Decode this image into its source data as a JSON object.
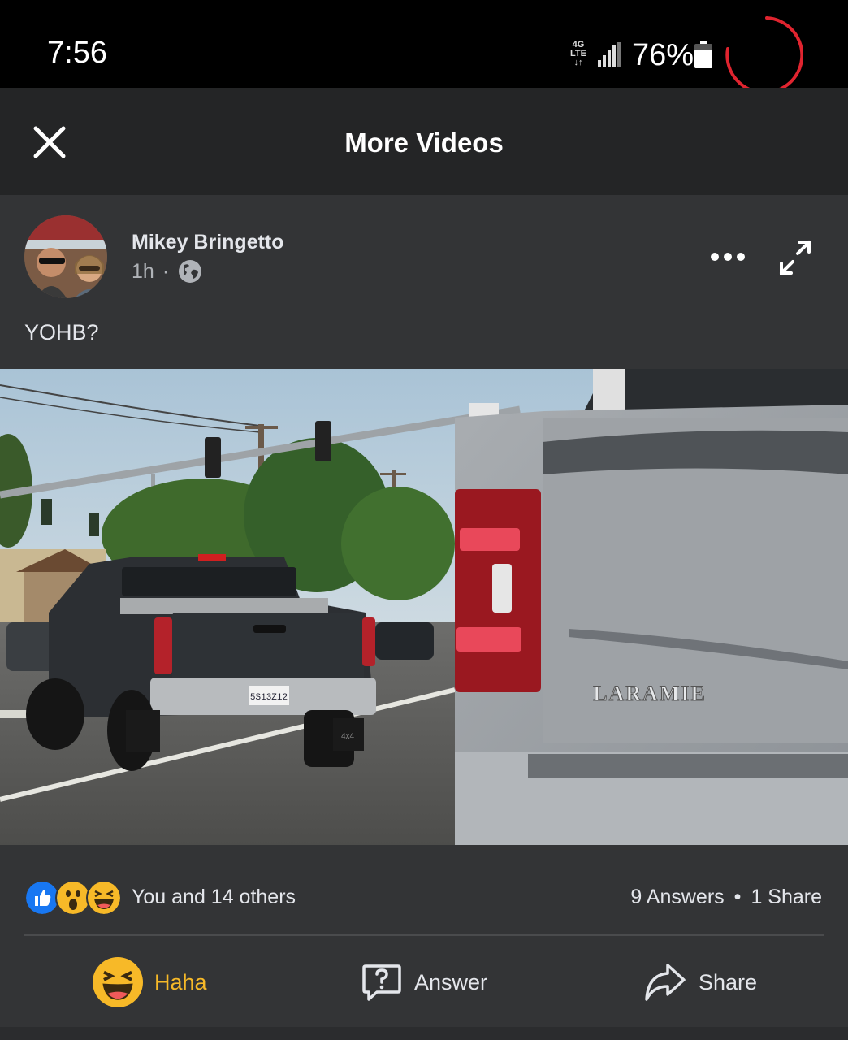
{
  "status_bar": {
    "time": "7:56",
    "network": "4G LTE",
    "battery_percent": "76%",
    "battery_level": 0.76,
    "spinner_color": "#e0242f"
  },
  "header": {
    "title": "More Videos",
    "close_icon": "close-icon"
  },
  "post": {
    "author": "Mikey Bringetto",
    "time_ago": "1h",
    "separator": "·",
    "privacy_icon": "globe-icon",
    "caption": "YOHB?",
    "more_icon": "more-horizontal-icon",
    "expand_icon": "expand-icon"
  },
  "video": {
    "plate_text": "5S13Z12",
    "tailgate_badge": "LARAMIE",
    "left_truck_badge": "4x4"
  },
  "engagement": {
    "reaction_icons": [
      "like-icon",
      "wow-icon",
      "haha-icon"
    ],
    "reactions_text": "You and 14 others",
    "answers": "9 Answers",
    "dot": "•",
    "shares": "1 Share"
  },
  "actions": {
    "haha_label": "Haha",
    "answer_label": "Answer",
    "share_label": "Share",
    "haha_color": "#f7b928"
  }
}
